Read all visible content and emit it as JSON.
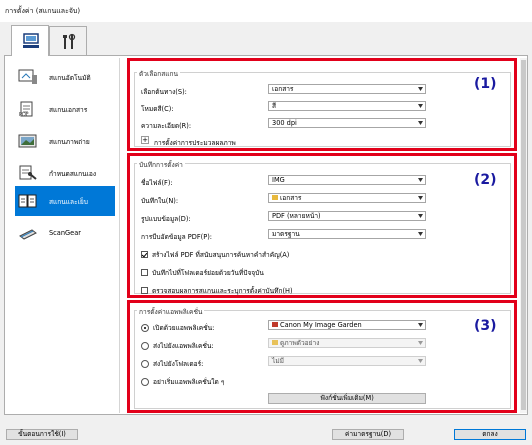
{
  "window": {
    "title": "การตั้งค่า (สแกนและจับ)"
  },
  "tabs": [
    {
      "icon": "computer-scanner-icon"
    },
    {
      "icon": "tools-icon"
    }
  ],
  "sidebar": {
    "items": [
      {
        "label": "สแกนอัตโนมัติ",
        "icon": "auto-scan-icon"
      },
      {
        "label": "สแกนเอกสาร",
        "icon": "document-scan-icon"
      },
      {
        "label": "สแกนภาพถ่าย",
        "icon": "photo-scan-icon"
      },
      {
        "label": "กำหนดสแกนเอง",
        "icon": "custom-scan-icon"
      },
      {
        "label": "สแกนและเย็บ",
        "icon": "scan-stitch-icon"
      },
      {
        "label": "ScanGear",
        "icon": "scangear-icon"
      }
    ]
  },
  "scan_options": {
    "title": "ตัวเลือกสแกน",
    "source_label": "เลือกต้นทาง(S):",
    "source_value": "เอกสาร",
    "color_label": "โหมดสี(C):",
    "color_value": "สี",
    "resolution_label": "ความละเอียด(R):",
    "resolution_value": "300 dpi",
    "image_processing_label": "การตั้งค่าการประมวลผลภาพ",
    "number": "(1)"
  },
  "save_settings": {
    "title": "บันทึกการตั้งค่า",
    "filename_label": "ชื่อไฟล์(F):",
    "filename_value": "IMG",
    "savein_label": "บันทึกใน(N):",
    "savein_value": "เอกสาร",
    "format_label": "รูปแบบข้อมูล(D):",
    "format_value": "PDF (หลายหน้า)",
    "pdf_label": "การบีบอัดข้อมูล PDF(P):",
    "pdf_value": "มาตรฐาน",
    "cb1": "สร้างไฟล์ PDF ที่สนับสนุนการค้นหาคำสำคัญ(A)",
    "cb2": "บันทึกไปที่โฟลเดอร์ย่อยด้วยวันที่ปัจจุบัน",
    "cb3": "ตรวจสอบผลการสแกนและระบุการตั้งค่าบันทึก(H)",
    "number": "(2)"
  },
  "app_settings": {
    "title": "การตั้งค่าแอพพลิเคชั่น",
    "r1": "เปิดด้วยแอพพลิเคชั่น:",
    "r1_value": "Canon My Image Garden",
    "r2": "ส่งไปยังแอพพลิเคชั่น:",
    "r2_value": "ดูภาพตัวอย่าง",
    "r3": "ส่งไปยังโฟลเดอร์:",
    "r3_value": "ไม่มี",
    "r4": "อย่าเริ่มแอพพลิเคชั่นใด ๆ",
    "add_button": "ฟังก์ชั่นเพิ่มเติม(M)",
    "number": "(3)"
  },
  "footer": {
    "instructions": "ขั้นตอนการใช้(I)",
    "defaults": "ค่ามาตรฐาน(D)",
    "ok": "ตกลง"
  }
}
